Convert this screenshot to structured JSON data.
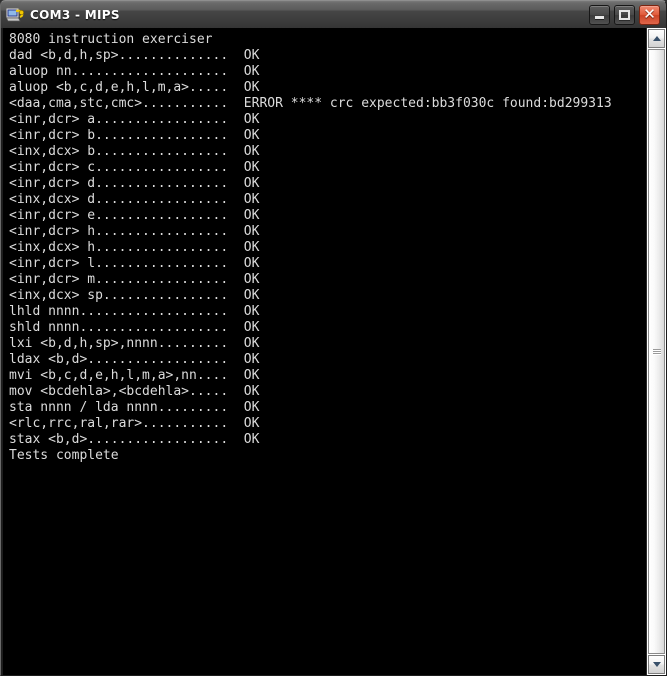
{
  "window": {
    "title": "COM3 - MIPS",
    "icon": "serial-terminal-icon",
    "controls": {
      "minimize_label": "Minimize",
      "maximize_label": "Maximize",
      "close_label": "Close",
      "close_glyph": "✕"
    },
    "colors": {
      "titlebar_top": "#7a7a7a",
      "titlebar_bottom": "#333333",
      "close_button": "#e15c3c",
      "terminal_background": "#000000",
      "terminal_text": "#dcdcdc"
    }
  },
  "terminal": {
    "lines": [
      "8080 instruction exerciser",
      "dad <b,d,h,sp>..............  OK",
      "aluop nn....................  OK",
      "aluop <b,c,d,e,h,l,m,a>.....  OK",
      "<daa,cma,stc,cmc>...........  ERROR **** crc expected:bb3f030c found:bd299313",
      "<inr,dcr> a.................  OK",
      "<inr,dcr> b.................  OK",
      "<inx,dcx> b.................  OK",
      "<inr,dcr> c.................  OK",
      "<inr,dcr> d.................  OK",
      "<inx,dcx> d.................  OK",
      "<inr,dcr> e.................  OK",
      "<inr,dcr> h.................  OK",
      "<inx,dcx> h.................  OK",
      "<inr,dcr> l.................  OK",
      "<inr,dcr> m.................  OK",
      "<inx,dcx> sp................  OK",
      "lhld nnnn...................  OK",
      "shld nnnn...................  OK",
      "lxi <b,d,h,sp>,nnnn.........  OK",
      "ldax <b,d>..................  OK",
      "mvi <b,c,d,e,h,l,m,a>,nn....  OK",
      "mov <bcdehla>,<bcdehla>.....  OK",
      "sta nnnn / lda nnnn.........  OK",
      "<rlc,rrc,ral,rar>...........  OK",
      "stax <b,d>..................  OK",
      "Tests complete"
    ]
  },
  "scrollbar": {
    "up_arrow": "scroll-up",
    "down_arrow": "scroll-down",
    "thumb_position_percent": 0,
    "thumb_size_percent": 100
  }
}
